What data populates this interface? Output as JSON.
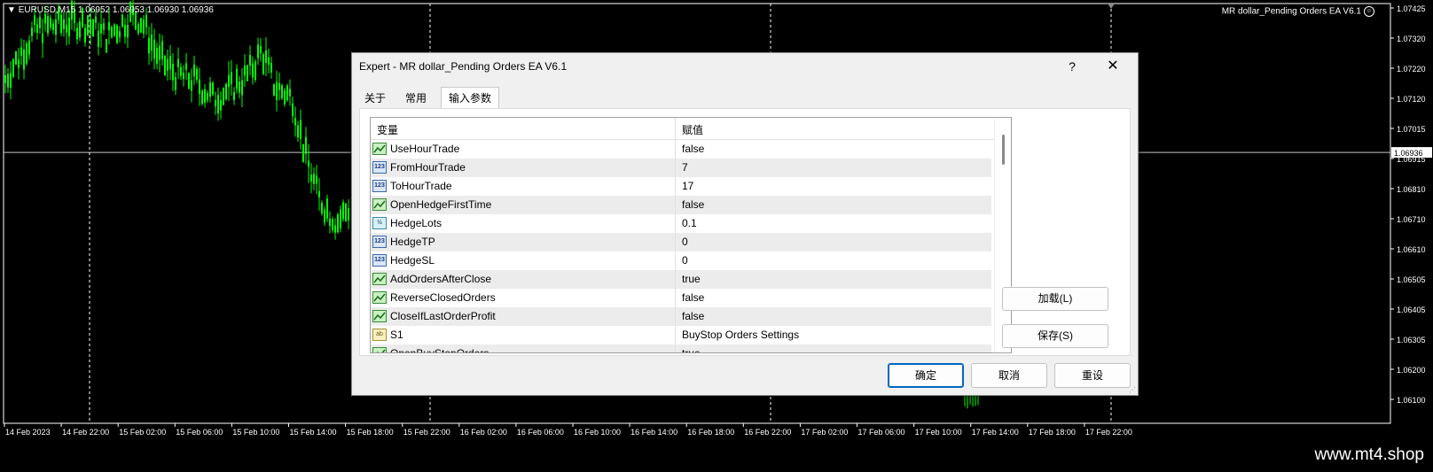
{
  "chart": {
    "symbol_info": "EURUSD,M15  1.06952 1.06953 1.06930 1.06936",
    "ea_name": "MR dollar_Pending Orders EA V6.1",
    "current_price": "1.06936",
    "price_ticks": [
      "1.07425",
      "1.07320",
      "1.07220",
      "1.07120",
      "1.07015",
      "1.06915",
      "1.06810",
      "1.06710",
      "1.06610",
      "1.06505",
      "1.06405",
      "1.06305",
      "1.06200",
      "1.06100"
    ],
    "time_ticks": [
      "14 Feb 2023",
      "14 Feb 22:00",
      "15 Feb 02:00",
      "15 Feb 06:00",
      "15 Feb 10:00",
      "15 Feb 14:00",
      "15 Feb 18:00",
      "15 Feb 22:00",
      "16 Feb 02:00",
      "16 Feb 06:00",
      "16 Feb 10:00",
      "16 Feb 14:00",
      "16 Feb 18:00",
      "16 Feb 22:00",
      "17 Feb 02:00",
      "17 Feb 06:00",
      "17 Feb 10:00",
      "17 Feb 14:00",
      "17 Feb 18:00",
      "17 Feb 22:00"
    ],
    "candle_color": "#00ff00",
    "grid_color": "#ffffff"
  },
  "footer": {
    "watermark": "www.mt4.shop"
  },
  "dialog": {
    "title": "Expert - MR dollar_Pending Orders EA V6.1",
    "help": "?",
    "close": "✕",
    "tabs": [
      {
        "label": "关于"
      },
      {
        "label": "常用"
      },
      {
        "label": "输入参数"
      }
    ],
    "grid": {
      "col_variable": "变量",
      "col_value": "赋值",
      "rows": [
        {
          "icon": "bool",
          "icon_text": "",
          "name": "UseHourTrade",
          "value": "false"
        },
        {
          "icon": "int",
          "icon_text": "123",
          "name": "FromHourTrade",
          "value": "7"
        },
        {
          "icon": "int",
          "icon_text": "123",
          "name": "ToHourTrade",
          "value": "17"
        },
        {
          "icon": "bool",
          "icon_text": "",
          "name": "OpenHedgeFirstTime",
          "value": "false"
        },
        {
          "icon": "dbl",
          "icon_text": "½",
          "name": "HedgeLots",
          "value": "0.1"
        },
        {
          "icon": "int",
          "icon_text": "123",
          "name": "HedgeTP",
          "value": "0"
        },
        {
          "icon": "int",
          "icon_text": "123",
          "name": "HedgeSL",
          "value": "0"
        },
        {
          "icon": "bool",
          "icon_text": "",
          "name": "AddOrdersAfterClose",
          "value": "true"
        },
        {
          "icon": "bool",
          "icon_text": "",
          "name": "ReverseClosedOrders",
          "value": "false"
        },
        {
          "icon": "bool",
          "icon_text": "",
          "name": "CloseIfLastOrderProfit",
          "value": "false"
        },
        {
          "icon": "str",
          "icon_text": "ab",
          "name": "S1",
          "value": "BuyStop Orders Settings"
        },
        {
          "icon": "bool",
          "icon_text": "",
          "name": "OpenBuyStopOrders",
          "value": "true"
        }
      ]
    },
    "buttons": {
      "load": "加载(L)",
      "save": "保存(S)",
      "ok": "确定",
      "cancel": "取消",
      "reset": "重设"
    }
  }
}
